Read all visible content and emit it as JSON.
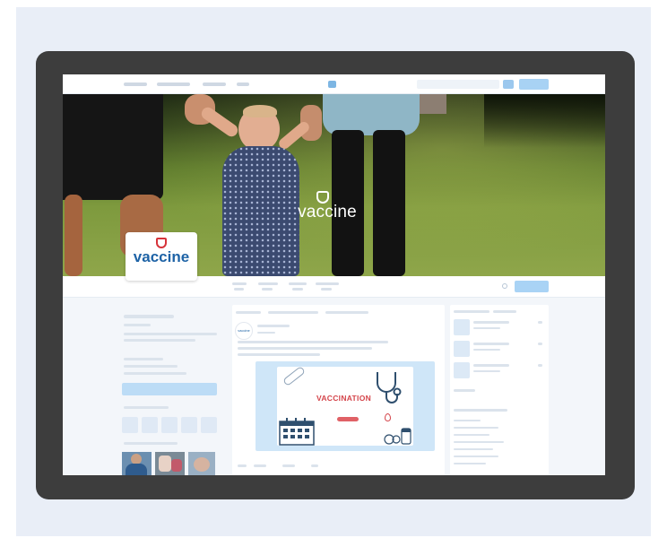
{
  "cover": {
    "logo_text": "vaccine"
  },
  "profile": {
    "name": "vaccine"
  },
  "post": {
    "avatar_text": "vaccine",
    "image_title": "VACCINATION"
  },
  "colors": {
    "device_frame": "#3d3d3d",
    "backdrop": "#e9eef7",
    "brand_blue": "#1e63a6",
    "brand_red": "#d6333a",
    "accent_light_blue": "#a9d3f5"
  },
  "icons": [
    "shield-icon",
    "stethoscope-icon",
    "calendar-icon",
    "bandage-icon",
    "pills-icon",
    "drop-icon",
    "search-icon"
  ]
}
